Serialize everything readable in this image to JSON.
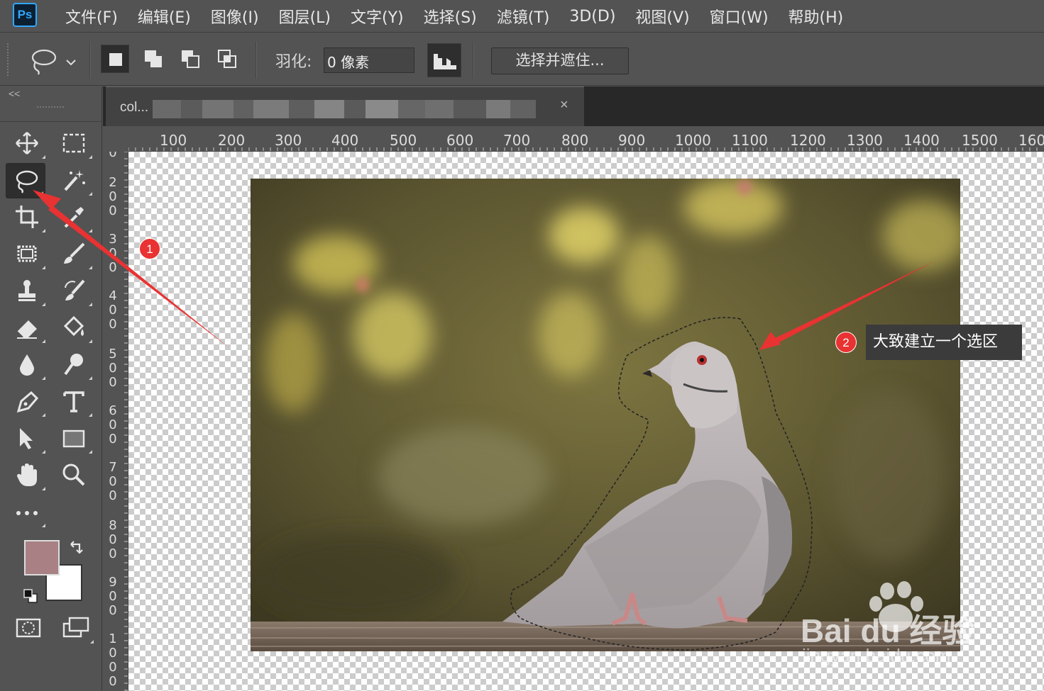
{
  "app": {
    "logo_text": "Ps"
  },
  "menu": [
    "文件(F)",
    "编辑(E)",
    "图像(I)",
    "图层(L)",
    "文字(Y)",
    "选择(S)",
    "滤镜(T)",
    "3D(D)",
    "视图(V)",
    "窗口(W)",
    "帮助(H)"
  ],
  "options": {
    "feather_label": "羽化:",
    "feather_value": "0 像素",
    "select_mask_label": "选择并遮住..."
  },
  "toolbar": {
    "collapse_label": "<<",
    "tools": [
      "move-tool",
      "rect-marquee-tool",
      "lasso-tool",
      "magic-wand-tool",
      "crop-tool",
      "eyedropper-tool",
      "frame-tool",
      "brush-tool",
      "stamp-tool",
      "history-brush-tool",
      "eraser-tool",
      "paint-bucket-tool",
      "blur-tool",
      "dodge-tool",
      "pen-tool",
      "type-tool",
      "path-select-tool",
      "rectangle-tool",
      "hand-tool",
      "zoom-tool",
      "more-tools"
    ],
    "foreground_color": "#a98084",
    "background_color": "#ffffff"
  },
  "document": {
    "tab_title": "col...",
    "tab_close": "×",
    "h_ruler": [
      "100",
      "200",
      "300",
      "400",
      "500",
      "600",
      "700",
      "800",
      "900",
      "1000",
      "1100",
      "1200",
      "1300",
      "1400",
      "1500",
      "160"
    ],
    "v_ruler": [
      [
        "0"
      ],
      [
        "2",
        "0",
        "0"
      ],
      [
        "3",
        "0",
        "0"
      ],
      [
        "4",
        "0",
        "0"
      ],
      [
        "5",
        "0",
        "0"
      ],
      [
        "6",
        "0",
        "0"
      ],
      [
        "7",
        "0",
        "0"
      ],
      [
        "8",
        "0",
        "0"
      ],
      [
        "9",
        "0",
        "0"
      ],
      [
        "1",
        "0",
        "0",
        "0"
      ]
    ]
  },
  "annotations": {
    "badge1": "1",
    "badge2": "2",
    "callout_text": "大致建立一个选区",
    "accent_color": "#e93232"
  },
  "watermark": {
    "brand": "Bai du 经验",
    "url": "jingyan.baidu.com"
  }
}
